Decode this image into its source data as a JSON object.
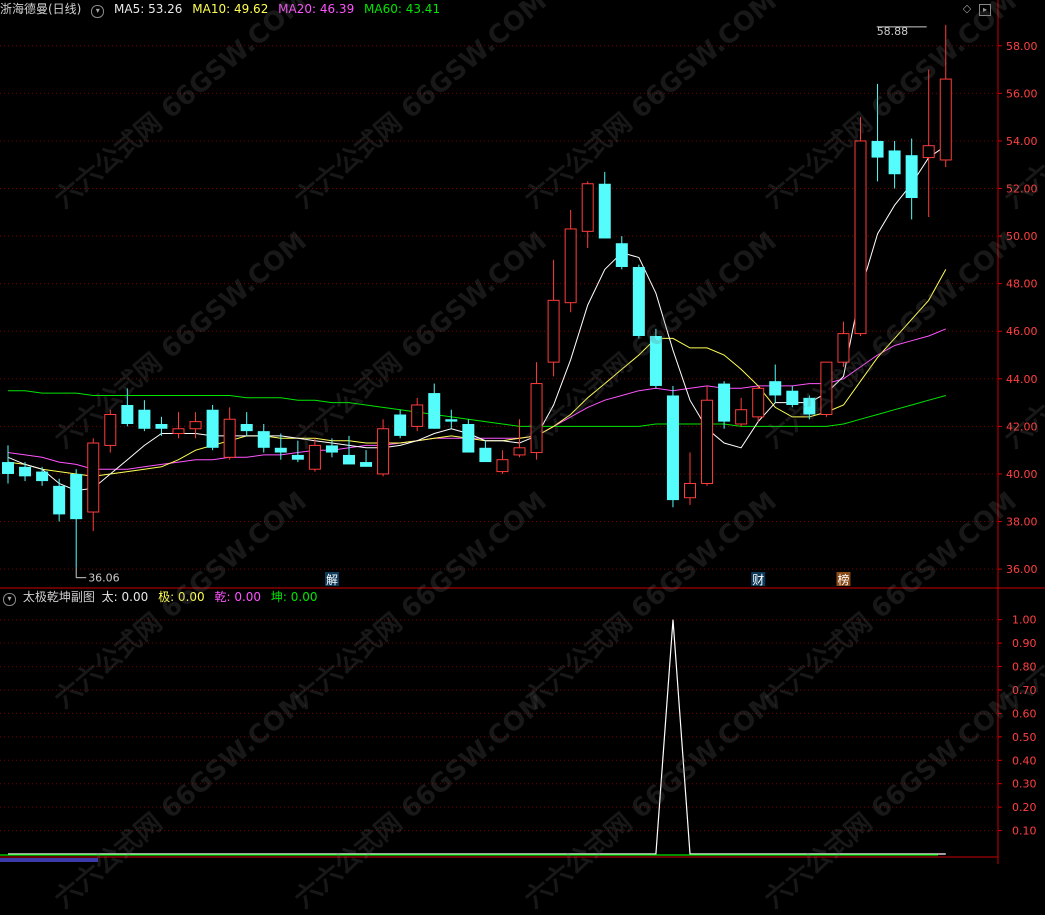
{
  "header": {
    "stock_name": "浙海德曼(日线)",
    "ma5": "MA5: 53.26",
    "ma10": "MA10: 49.62",
    "ma20": "MA20: 46.39",
    "ma60": "MA60: 43.41"
  },
  "indicator_header": {
    "name": "太极乾坤副图",
    "tai": "太: 0.00",
    "ji": "极: 0.00",
    "qian": "乾: 0.00",
    "kun": "坤: 0.00"
  },
  "icons": {
    "collapse": "chevron-down-icon",
    "diamond": "diamond-icon",
    "scroll": "scroll-box-icon"
  },
  "watermark": "六六公式网 66GSW.COM",
  "colors": {
    "up": "#ff3c3c",
    "down": "#54fcfc",
    "ma5": "#ffffff",
    "ma10": "#ffff54",
    "ma20": "#ff54ff",
    "ma60": "#00e600",
    "axis": "#cc0000",
    "grid": "#7a0000",
    "label": "#ff4040",
    "spike": "#ffffff"
  },
  "markers": [
    {
      "text": "解",
      "index": 19
    },
    {
      "text": "财",
      "index": 44
    },
    {
      "text": "榜",
      "index": 49
    }
  ],
  "chart_data": [
    {
      "type": "candlestick",
      "title": "浙海德曼(日线)",
      "ylim": [
        35.5,
        59.0
      ],
      "y_ticks": [
        "58.00",
        "56.00",
        "54.00",
        "52.00",
        "50.00",
        "48.00",
        "46.00",
        "44.00",
        "42.00",
        "40.00",
        "38.00",
        "36.00"
      ],
      "annotations": [
        {
          "text": "58.88",
          "index": 54,
          "value": 58.88
        },
        {
          "text": "36.06",
          "index": 4,
          "value": 36.06
        }
      ],
      "ohlc": [
        [
          40.5,
          41.2,
          39.6,
          40.0
        ],
        [
          40.3,
          40.5,
          39.7,
          39.9
        ],
        [
          40.1,
          40.3,
          39.5,
          39.7
        ],
        [
          39.5,
          39.8,
          38.0,
          38.3
        ],
        [
          40.0,
          40.2,
          36.06,
          38.1
        ],
        [
          38.4,
          41.5,
          37.6,
          41.3
        ],
        [
          41.2,
          42.7,
          40.9,
          42.5
        ],
        [
          42.9,
          43.6,
          42.0,
          42.1
        ],
        [
          42.7,
          43.1,
          41.8,
          41.9
        ],
        [
          42.1,
          42.4,
          41.6,
          41.9
        ],
        [
          41.7,
          42.6,
          41.5,
          41.9
        ],
        [
          41.9,
          42.6,
          41.5,
          42.2
        ],
        [
          42.7,
          42.9,
          41.0,
          41.1
        ],
        [
          40.7,
          42.8,
          40.6,
          42.3
        ],
        [
          42.1,
          42.6,
          41.6,
          41.8
        ],
        [
          41.8,
          42.1,
          40.9,
          41.1
        ],
        [
          41.1,
          41.7,
          40.6,
          40.9
        ],
        [
          40.8,
          41.4,
          40.5,
          40.6
        ],
        [
          40.2,
          41.5,
          40.1,
          41.2
        ],
        [
          41.2,
          41.5,
          40.7,
          40.9
        ],
        [
          40.8,
          41.6,
          40.5,
          40.4
        ],
        [
          40.5,
          41.0,
          40.4,
          40.3
        ],
        [
          40.0,
          42.3,
          39.9,
          41.9
        ],
        [
          42.5,
          42.7,
          41.5,
          41.6
        ],
        [
          42.0,
          43.2,
          41.8,
          42.9
        ],
        [
          43.4,
          43.8,
          41.9,
          41.9
        ],
        [
          42.3,
          42.7,
          41.9,
          42.2
        ],
        [
          42.1,
          42.3,
          40.9,
          40.9
        ],
        [
          41.1,
          41.4,
          40.5,
          40.5
        ],
        [
          40.1,
          41.0,
          40.0,
          40.6
        ],
        [
          40.8,
          42.3,
          40.7,
          41.1
        ],
        [
          40.9,
          44.7,
          40.6,
          43.8
        ],
        [
          44.7,
          49.0,
          44.1,
          47.3
        ],
        [
          47.2,
          51.1,
          46.8,
          50.3
        ],
        [
          50.2,
          52.3,
          49.5,
          52.2
        ],
        [
          52.2,
          52.7,
          49.9,
          49.9
        ],
        [
          49.7,
          50.0,
          48.6,
          48.7
        ],
        [
          48.7,
          48.8,
          45.7,
          45.8
        ],
        [
          45.8,
          46.1,
          43.6,
          43.7
        ],
        [
          43.3,
          43.7,
          38.6,
          38.9
        ],
        [
          39.0,
          40.9,
          38.7,
          39.6
        ],
        [
          39.6,
          43.7,
          39.5,
          43.1
        ],
        [
          43.8,
          43.9,
          41.9,
          42.2
        ],
        [
          42.1,
          43.2,
          42.0,
          42.7
        ],
        [
          42.4,
          43.7,
          42.2,
          43.6
        ],
        [
          43.9,
          44.6,
          43.0,
          43.3
        ],
        [
          43.5,
          43.7,
          42.8,
          42.9
        ],
        [
          43.2,
          43.3,
          42.3,
          42.5
        ],
        [
          42.5,
          44.2,
          42.4,
          44.7
        ],
        [
          44.7,
          46.4,
          44.5,
          45.9
        ],
        [
          45.9,
          55.0,
          45.8,
          54.0
        ],
        [
          54.0,
          56.4,
          52.3,
          53.3
        ],
        [
          53.6,
          54.0,
          52.0,
          52.6
        ],
        [
          53.4,
          54.1,
          50.7,
          51.6
        ],
        [
          53.3,
          57.0,
          50.8,
          53.8
        ],
        [
          53.2,
          58.88,
          52.9,
          56.6
        ]
      ],
      "ma5": [
        40.7,
        40.4,
        40.2,
        39.6,
        39.3,
        39.4,
        40.0,
        40.6,
        41.2,
        41.7,
        41.7,
        41.7,
        41.6,
        41.6,
        41.6,
        41.6,
        41.6,
        41.5,
        41.4,
        41.3,
        41.2,
        41.1,
        41.1,
        41.2,
        41.4,
        41.7,
        41.9,
        41.7,
        41.4,
        41.4,
        41.3,
        41.6,
        42.9,
        44.8,
        47.1,
        48.6,
        49.3,
        49.1,
        47.6,
        45.2,
        43.1,
        41.9,
        41.3,
        41.1,
        42.2,
        43.0,
        43.0,
        43.0,
        43.4,
        44.1,
        47.7,
        50.1,
        51.3,
        52.2,
        53.3,
        53.8
      ],
      "ma10": [
        40.5,
        40.4,
        40.2,
        40.1,
        40.0,
        39.9,
        40.0,
        40.1,
        40.2,
        40.3,
        40.6,
        41.0,
        41.2,
        41.4,
        41.6,
        41.6,
        41.5,
        41.5,
        41.5,
        41.4,
        41.4,
        41.3,
        41.3,
        41.3,
        41.4,
        41.5,
        41.6,
        41.5,
        41.4,
        41.4,
        41.5,
        41.6,
        42.0,
        42.5,
        43.2,
        43.8,
        44.4,
        45.0,
        45.7,
        45.7,
        45.3,
        45.3,
        45.0,
        44.4,
        43.7,
        42.8,
        42.4,
        42.4,
        42.6,
        42.9,
        43.9,
        44.9,
        45.7,
        46.5,
        47.3,
        48.6
      ],
      "ma20": [
        40.9,
        40.8,
        40.7,
        40.5,
        40.4,
        40.2,
        40.2,
        40.2,
        40.3,
        40.4,
        40.5,
        40.6,
        40.6,
        40.7,
        40.7,
        40.8,
        40.8,
        40.9,
        41.0,
        41.0,
        41.1,
        41.2,
        41.2,
        41.3,
        41.4,
        41.5,
        41.5,
        41.5,
        41.5,
        41.5,
        41.5,
        41.6,
        42.0,
        42.4,
        42.8,
        43.1,
        43.3,
        43.5,
        43.6,
        43.5,
        43.6,
        43.7,
        43.6,
        43.6,
        43.7,
        43.7,
        43.7,
        43.8,
        43.8,
        44.0,
        44.5,
        45.0,
        45.4,
        45.6,
        45.8,
        46.1
      ],
      "ma60": [
        43.5,
        43.5,
        43.4,
        43.4,
        43.4,
        43.3,
        43.3,
        43.3,
        43.3,
        43.3,
        43.3,
        43.3,
        43.3,
        43.3,
        43.2,
        43.2,
        43.2,
        43.1,
        43.1,
        43.0,
        43.0,
        42.9,
        42.8,
        42.7,
        42.6,
        42.5,
        42.4,
        42.3,
        42.2,
        42.1,
        42.0,
        42.0,
        42.0,
        42.0,
        42.0,
        42.0,
        42.0,
        42.0,
        42.1,
        42.1,
        42.1,
        42.1,
        42.1,
        42.0,
        42.0,
        42.0,
        42.0,
        42.0,
        42.0,
        42.1,
        42.3,
        42.5,
        42.7,
        42.9,
        43.1,
        43.3
      ]
    },
    {
      "type": "line",
      "title": "太极乾坤副图",
      "ylim": [
        0.0,
        1.05
      ],
      "y_ticks": [
        "1.00",
        "0.90",
        "0.80",
        "0.70",
        "0.60",
        "0.50",
        "0.40",
        "0.30",
        "0.20",
        "0.10"
      ],
      "series": [
        {
          "name": "太",
          "values": [
            0,
            0,
            0,
            0,
            0,
            0,
            0,
            0,
            0,
            0,
            0,
            0,
            0,
            0,
            0,
            0,
            0,
            0,
            0,
            0,
            0,
            0,
            0,
            0,
            0,
            0,
            0,
            0,
            0,
            0,
            0,
            0,
            0,
            0,
            0,
            0,
            0,
            0,
            0,
            1,
            0,
            0,
            0,
            0,
            0,
            0,
            0,
            0,
            0,
            0,
            0,
            0,
            0,
            0,
            0,
            0
          ]
        }
      ]
    }
  ]
}
